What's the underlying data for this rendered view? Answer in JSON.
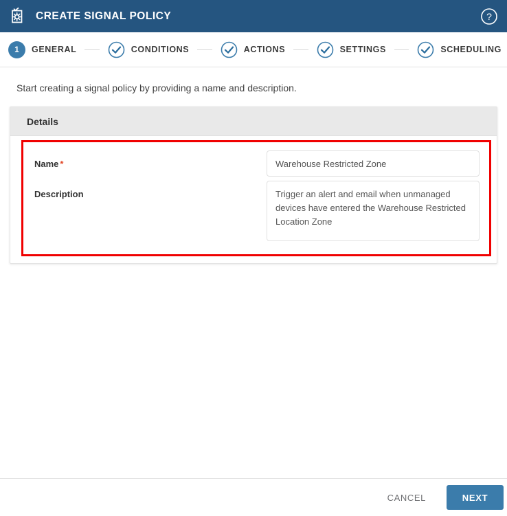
{
  "header": {
    "title": "CREATE SIGNAL POLICY",
    "app_icon": "signal-policy-icon",
    "help_icon": "help-circle-icon",
    "background_color": "#255580"
  },
  "stepper": {
    "accent_color": "#3b7cab",
    "steps": [
      {
        "label": "GENERAL",
        "state": "current",
        "marker": "1"
      },
      {
        "label": "CONDITIONS",
        "state": "done",
        "marker": "check-icon"
      },
      {
        "label": "ACTIONS",
        "state": "done",
        "marker": "check-icon"
      },
      {
        "label": "SETTINGS",
        "state": "done",
        "marker": "check-icon"
      },
      {
        "label": "SCHEDULING",
        "state": "done",
        "marker": "check-icon"
      }
    ]
  },
  "main": {
    "intro_text": "Start creating a signal policy by providing a name and description.",
    "panel": {
      "title": "Details",
      "highlight_color": "#f00000",
      "fields": {
        "name": {
          "label": "Name",
          "required": true,
          "required_marker": "*",
          "value": "Warehouse Restricted Zone",
          "placeholder": ""
        },
        "description": {
          "label": "Description",
          "required": false,
          "value": "Trigger an alert and email when unmanaged devices have entered the Warehouse Restricted Location Zone",
          "placeholder": ""
        }
      }
    }
  },
  "footer": {
    "cancel_label": "CANCEL",
    "next_label": "NEXT",
    "next_color": "#3b7cab"
  }
}
